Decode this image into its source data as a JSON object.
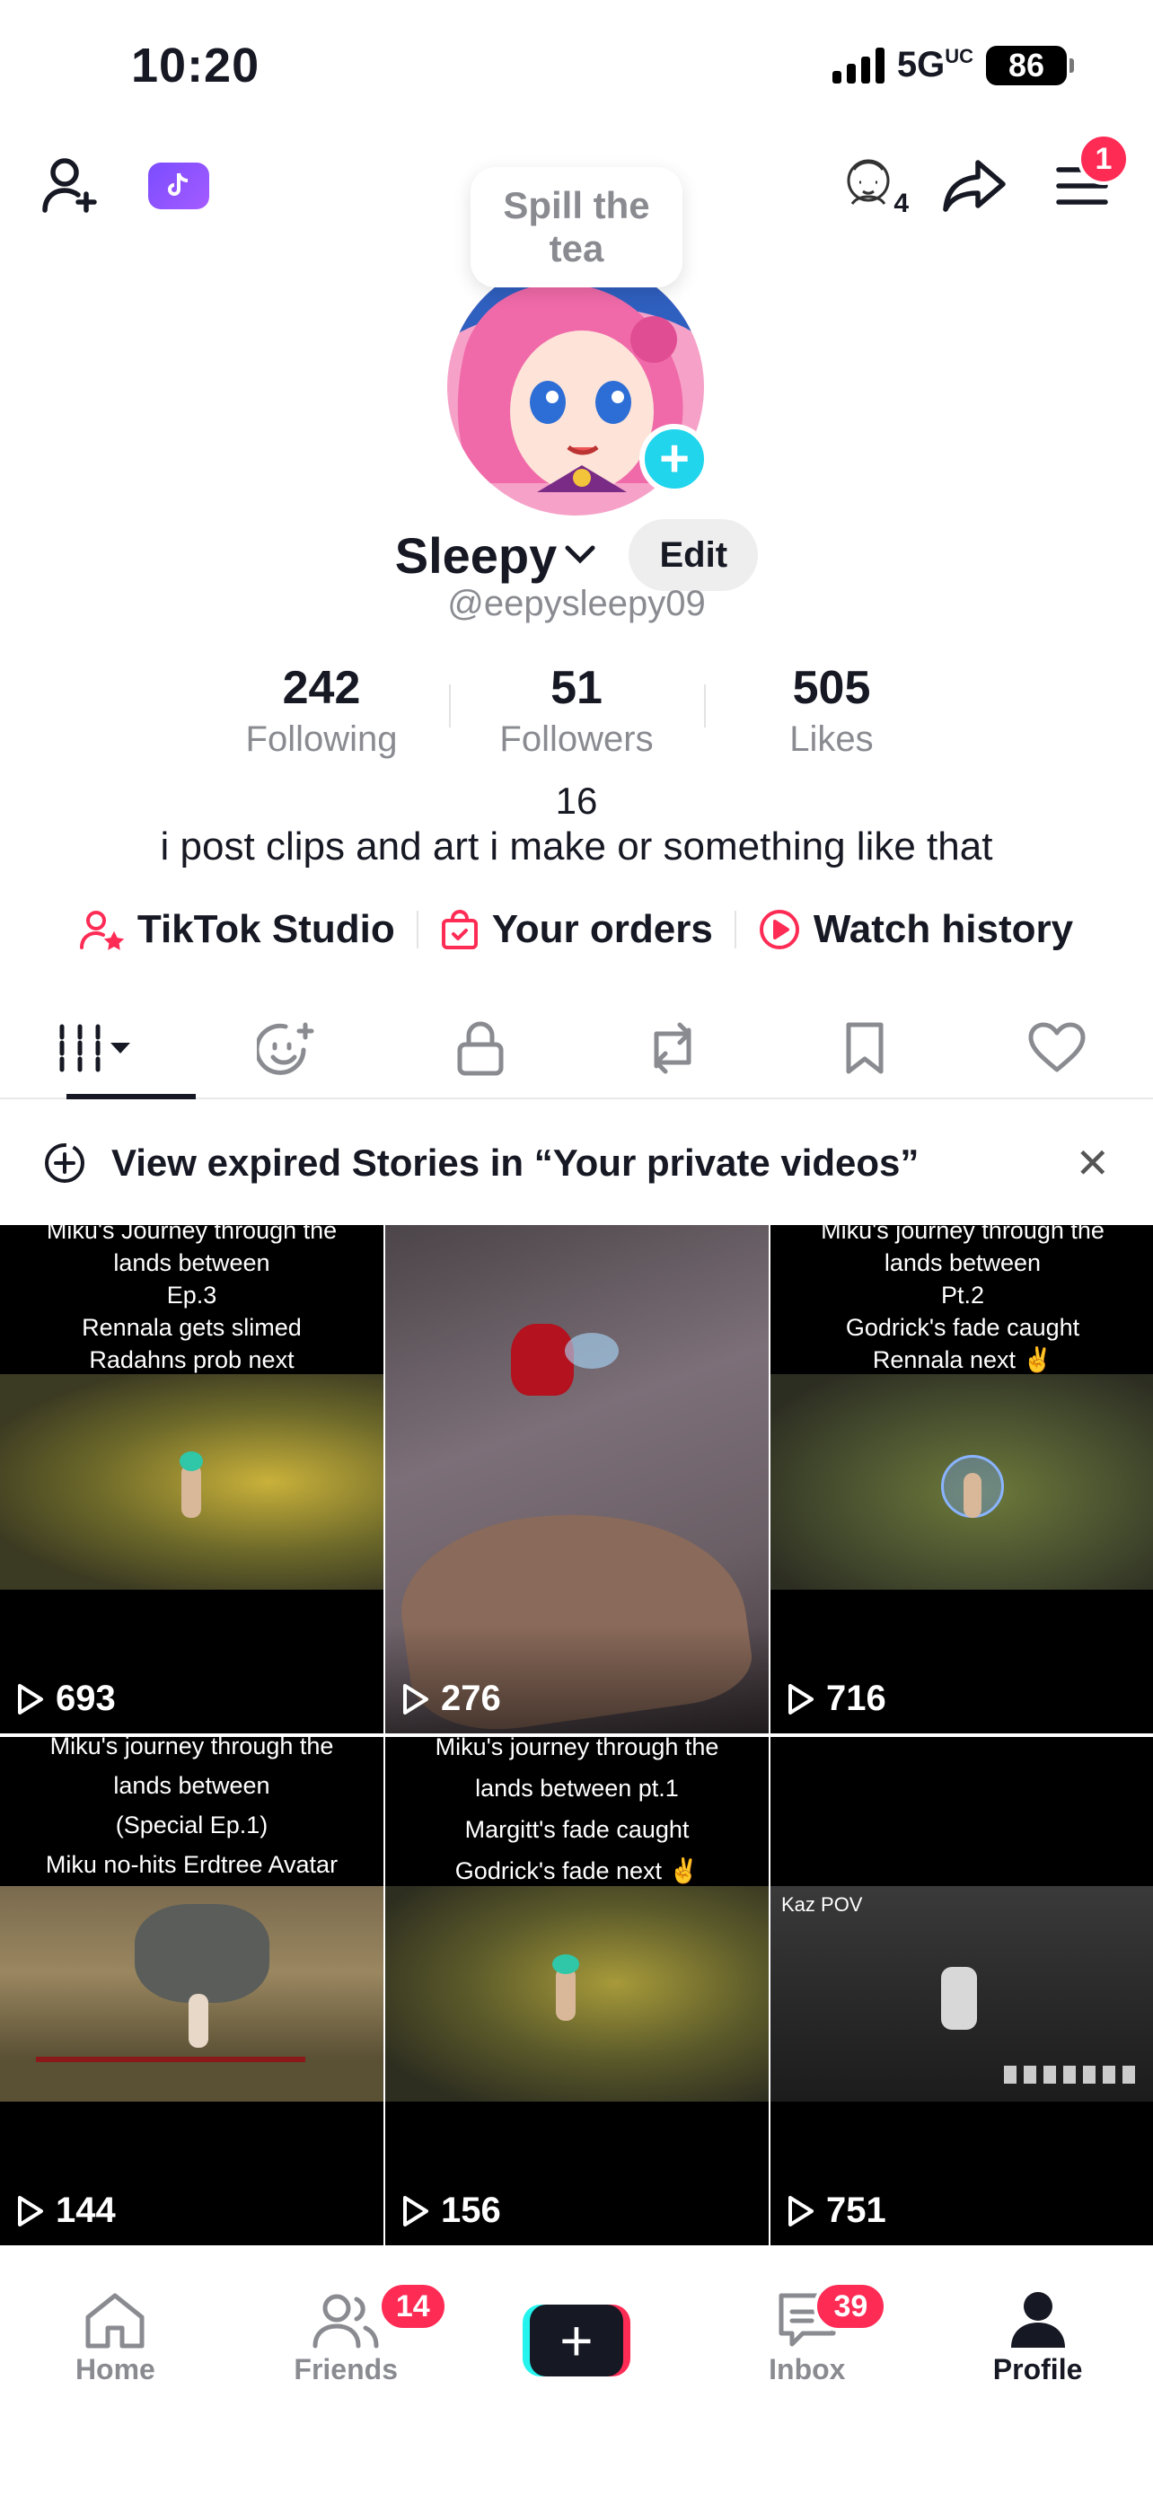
{
  "status_bar": {
    "time": "10:20",
    "network": "5G",
    "network_sup": "UC",
    "battery": "86"
  },
  "top_bar": {
    "menu_badge": "1",
    "friends_count": "4"
  },
  "profile": {
    "tea_prompt": "Spill the tea",
    "name": "Sleepy",
    "edit_label": "Edit",
    "handle": "@eepysleepy09",
    "stats": [
      {
        "value": "242",
        "label": "Following"
      },
      {
        "value": "51",
        "label": "Followers"
      },
      {
        "value": "505",
        "label": "Likes"
      }
    ],
    "bio_number": "16",
    "bio": "i post clips and art i make or something like that"
  },
  "links": {
    "studio": "TikTok Studio",
    "orders": "Your orders",
    "history": "Watch history"
  },
  "notice": {
    "text": "View expired Stories in “Your private videos”"
  },
  "videos": [
    {
      "caption": "Miku's Journey through the\nlands between\nEp.3\nRennala gets slimed\nRadahns prob next",
      "views": "693"
    },
    {
      "caption": "",
      "views": "276"
    },
    {
      "caption": "Miku's journey through the\nlands between\nPt.2\nGodrick's fade caught\nRennala next ✌️",
      "views": "716"
    },
    {
      "caption": "Miku's journey through the\nlands between\n(Special Ep.1)\nMiku no-hits Erdtree Avatar",
      "views": "144"
    },
    {
      "caption": "Miku's journey through the\nlands between pt.1\nMargitt's fade caught\nGodrick's fade next ✌️",
      "views": "156"
    },
    {
      "caption": "",
      "views": "751",
      "overlay_label": "Kaz POV"
    }
  ],
  "bottom_nav": {
    "home": "Home",
    "friends": "Friends",
    "friends_badge": "14",
    "inbox": "Inbox",
    "inbox_badge": "39",
    "profile": "Profile"
  },
  "colors": {
    "accent": "#fe2c55",
    "cyan": "#25f4ee",
    "text": "#161823",
    "muted": "#8a8b91"
  }
}
